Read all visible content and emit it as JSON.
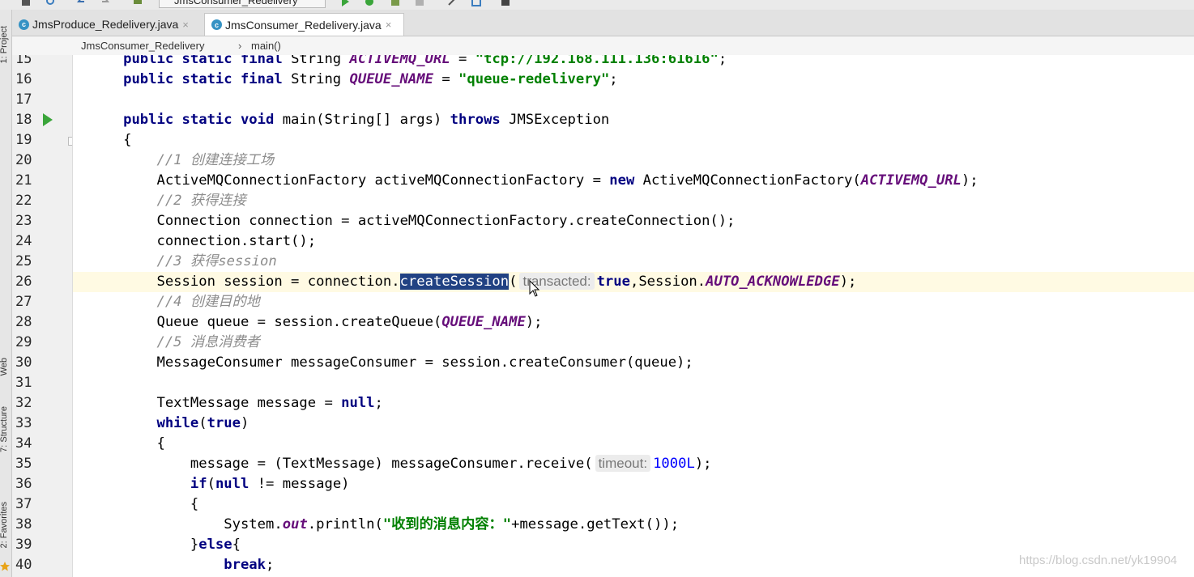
{
  "toolbar": {
    "run_config": "JmsConsumer_Redelivery",
    "icons": [
      "save-icon",
      "sync-icon",
      "back-icon",
      "forward-icon",
      "build-icon",
      "run-icon",
      "debug-icon",
      "coverage-icon",
      "stop-icon",
      "wrench-icon",
      "structure-icon",
      "terminal-icon"
    ]
  },
  "side_tools": {
    "project": "1: Project",
    "web": "Web",
    "structure": "7: Structure",
    "favorites": "2: Favorites"
  },
  "tabs": [
    {
      "label": "JmsProduce_Redelivery.java",
      "active": false
    },
    {
      "label": "JmsConsumer_Redelivery.java",
      "active": true
    }
  ],
  "breadcrumb": [
    "JmsConsumer_Redelivery",
    "main()"
  ],
  "editor": {
    "line_numbers": [
      "15",
      "16",
      "17",
      "18",
      "19",
      "20",
      "21",
      "22",
      "23",
      "24",
      "25",
      "26",
      "27",
      "28",
      "29",
      "30",
      "31",
      "32",
      "33",
      "34",
      "35",
      "36",
      "37",
      "38",
      "39",
      "40"
    ],
    "current_line": "26",
    "line15": {
      "kw": "public static final ",
      "t1": "String ",
      "c1": "ACTIVEMQ_URL",
      "t2": " = ",
      "s1": "\"tcp://192.168.111.136:61616\"",
      "t3": ";"
    },
    "line16": {
      "kw": "public static final ",
      "t1": "String ",
      "c1": "QUEUE_NAME",
      "t2": " = ",
      "s1": "\"queue-redelivery\"",
      "t3": ";"
    },
    "line18": {
      "kw1": "public static void ",
      "t1": "main(String[] args) ",
      "kw2": "throws ",
      "t2": "JMSException"
    },
    "line19": "{",
    "line20": "//1 创建连接工场",
    "line21": {
      "t1": "ActiveMQConnectionFactory activeMQConnectionFactory = ",
      "kw": "new ",
      "t2": "ActiveMQConnectionFactory(",
      "c1": "ACTIVEMQ_URL",
      "t3": ");"
    },
    "line22": "//2 获得连接",
    "line23": "Connection connection = activeMQConnectionFactory.createConnection();",
    "line24": "connection.start();",
    "line25": "//3 获得session",
    "line26": {
      "t1": "Session session = connection.",
      "sel": "createSession",
      "t2": "(",
      "hint": "transacted:",
      "kw": "true",
      "t3": ",Session.",
      "c1": "AUTO_ACKNOWLEDGE",
      "t4": ");"
    },
    "line27": "//4 创建目的地",
    "line28": {
      "t1": "Queue queue = session.createQueue(",
      "c1": "QUEUE_NAME",
      "t2": ");"
    },
    "line29": "//5 消息消费者",
    "line30": "MessageConsumer messageConsumer = session.createConsumer(queue);",
    "line32": {
      "t1": "TextMessage message = ",
      "kw": "null",
      "t2": ";"
    },
    "line33": {
      "kw1": "while",
      "t1": "(",
      "kw2": "true",
      "t2": ")"
    },
    "line34": "{",
    "line35": {
      "t1": "message = (TextMessage) messageConsumer.receive(",
      "hint": "timeout:",
      "num": "1000L",
      "t2": ");"
    },
    "line36": {
      "kw1": "if",
      "t1": "(",
      "kw2": "null",
      "t2": " != message)"
    },
    "line37": "{",
    "line38": {
      "t1": "System.",
      "c1": "out",
      "t2": ".println(",
      "s1": "\"收到的消息内容：\"",
      "t3": "+message.getText());"
    },
    "line39": {
      "t1": "}",
      "kw": "else",
      "t2": "{"
    },
    "line40": {
      "kw": "break",
      "t1": ";"
    }
  },
  "watermark": "https://blog.csdn.net/yk19904"
}
